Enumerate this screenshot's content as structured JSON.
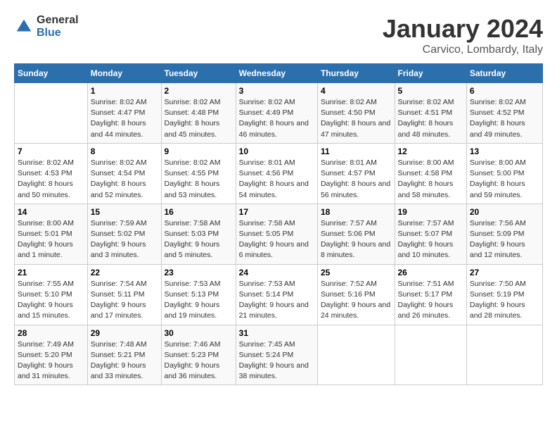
{
  "logo": {
    "general": "General",
    "blue": "Blue"
  },
  "title": "January 2024",
  "subtitle": "Carvico, Lombardy, Italy",
  "days_of_week": [
    "Sunday",
    "Monday",
    "Tuesday",
    "Wednesday",
    "Thursday",
    "Friday",
    "Saturday"
  ],
  "weeks": [
    [
      {
        "day": "",
        "sunrise": "",
        "sunset": "",
        "daylight": ""
      },
      {
        "day": "1",
        "sunrise": "Sunrise: 8:02 AM",
        "sunset": "Sunset: 4:47 PM",
        "daylight": "Daylight: 8 hours and 44 minutes."
      },
      {
        "day": "2",
        "sunrise": "Sunrise: 8:02 AM",
        "sunset": "Sunset: 4:48 PM",
        "daylight": "Daylight: 8 hours and 45 minutes."
      },
      {
        "day": "3",
        "sunrise": "Sunrise: 8:02 AM",
        "sunset": "Sunset: 4:49 PM",
        "daylight": "Daylight: 8 hours and 46 minutes."
      },
      {
        "day": "4",
        "sunrise": "Sunrise: 8:02 AM",
        "sunset": "Sunset: 4:50 PM",
        "daylight": "Daylight: 8 hours and 47 minutes."
      },
      {
        "day": "5",
        "sunrise": "Sunrise: 8:02 AM",
        "sunset": "Sunset: 4:51 PM",
        "daylight": "Daylight: 8 hours and 48 minutes."
      },
      {
        "day": "6",
        "sunrise": "Sunrise: 8:02 AM",
        "sunset": "Sunset: 4:52 PM",
        "daylight": "Daylight: 8 hours and 49 minutes."
      }
    ],
    [
      {
        "day": "7",
        "sunrise": "Sunrise: 8:02 AM",
        "sunset": "Sunset: 4:53 PM",
        "daylight": "Daylight: 8 hours and 50 minutes."
      },
      {
        "day": "8",
        "sunrise": "Sunrise: 8:02 AM",
        "sunset": "Sunset: 4:54 PM",
        "daylight": "Daylight: 8 hours and 52 minutes."
      },
      {
        "day": "9",
        "sunrise": "Sunrise: 8:02 AM",
        "sunset": "Sunset: 4:55 PM",
        "daylight": "Daylight: 8 hours and 53 minutes."
      },
      {
        "day": "10",
        "sunrise": "Sunrise: 8:01 AM",
        "sunset": "Sunset: 4:56 PM",
        "daylight": "Daylight: 8 hours and 54 minutes."
      },
      {
        "day": "11",
        "sunrise": "Sunrise: 8:01 AM",
        "sunset": "Sunset: 4:57 PM",
        "daylight": "Daylight: 8 hours and 56 minutes."
      },
      {
        "day": "12",
        "sunrise": "Sunrise: 8:00 AM",
        "sunset": "Sunset: 4:58 PM",
        "daylight": "Daylight: 8 hours and 58 minutes."
      },
      {
        "day": "13",
        "sunrise": "Sunrise: 8:00 AM",
        "sunset": "Sunset: 5:00 PM",
        "daylight": "Daylight: 8 hours and 59 minutes."
      }
    ],
    [
      {
        "day": "14",
        "sunrise": "Sunrise: 8:00 AM",
        "sunset": "Sunset: 5:01 PM",
        "daylight": "Daylight: 9 hours and 1 minute."
      },
      {
        "day": "15",
        "sunrise": "Sunrise: 7:59 AM",
        "sunset": "Sunset: 5:02 PM",
        "daylight": "Daylight: 9 hours and 3 minutes."
      },
      {
        "day": "16",
        "sunrise": "Sunrise: 7:58 AM",
        "sunset": "Sunset: 5:03 PM",
        "daylight": "Daylight: 9 hours and 5 minutes."
      },
      {
        "day": "17",
        "sunrise": "Sunrise: 7:58 AM",
        "sunset": "Sunset: 5:05 PM",
        "daylight": "Daylight: 9 hours and 6 minutes."
      },
      {
        "day": "18",
        "sunrise": "Sunrise: 7:57 AM",
        "sunset": "Sunset: 5:06 PM",
        "daylight": "Daylight: 9 hours and 8 minutes."
      },
      {
        "day": "19",
        "sunrise": "Sunrise: 7:57 AM",
        "sunset": "Sunset: 5:07 PM",
        "daylight": "Daylight: 9 hours and 10 minutes."
      },
      {
        "day": "20",
        "sunrise": "Sunrise: 7:56 AM",
        "sunset": "Sunset: 5:09 PM",
        "daylight": "Daylight: 9 hours and 12 minutes."
      }
    ],
    [
      {
        "day": "21",
        "sunrise": "Sunrise: 7:55 AM",
        "sunset": "Sunset: 5:10 PM",
        "daylight": "Daylight: 9 hours and 15 minutes."
      },
      {
        "day": "22",
        "sunrise": "Sunrise: 7:54 AM",
        "sunset": "Sunset: 5:11 PM",
        "daylight": "Daylight: 9 hours and 17 minutes."
      },
      {
        "day": "23",
        "sunrise": "Sunrise: 7:53 AM",
        "sunset": "Sunset: 5:13 PM",
        "daylight": "Daylight: 9 hours and 19 minutes."
      },
      {
        "day": "24",
        "sunrise": "Sunrise: 7:53 AM",
        "sunset": "Sunset: 5:14 PM",
        "daylight": "Daylight: 9 hours and 21 minutes."
      },
      {
        "day": "25",
        "sunrise": "Sunrise: 7:52 AM",
        "sunset": "Sunset: 5:16 PM",
        "daylight": "Daylight: 9 hours and 24 minutes."
      },
      {
        "day": "26",
        "sunrise": "Sunrise: 7:51 AM",
        "sunset": "Sunset: 5:17 PM",
        "daylight": "Daylight: 9 hours and 26 minutes."
      },
      {
        "day": "27",
        "sunrise": "Sunrise: 7:50 AM",
        "sunset": "Sunset: 5:19 PM",
        "daylight": "Daylight: 9 hours and 28 minutes."
      }
    ],
    [
      {
        "day": "28",
        "sunrise": "Sunrise: 7:49 AM",
        "sunset": "Sunset: 5:20 PM",
        "daylight": "Daylight: 9 hours and 31 minutes."
      },
      {
        "day": "29",
        "sunrise": "Sunrise: 7:48 AM",
        "sunset": "Sunset: 5:21 PM",
        "daylight": "Daylight: 9 hours and 33 minutes."
      },
      {
        "day": "30",
        "sunrise": "Sunrise: 7:46 AM",
        "sunset": "Sunset: 5:23 PM",
        "daylight": "Daylight: 9 hours and 36 minutes."
      },
      {
        "day": "31",
        "sunrise": "Sunrise: 7:45 AM",
        "sunset": "Sunset: 5:24 PM",
        "daylight": "Daylight: 9 hours and 38 minutes."
      },
      {
        "day": "",
        "sunrise": "",
        "sunset": "",
        "daylight": ""
      },
      {
        "day": "",
        "sunrise": "",
        "sunset": "",
        "daylight": ""
      },
      {
        "day": "",
        "sunrise": "",
        "sunset": "",
        "daylight": ""
      }
    ]
  ]
}
